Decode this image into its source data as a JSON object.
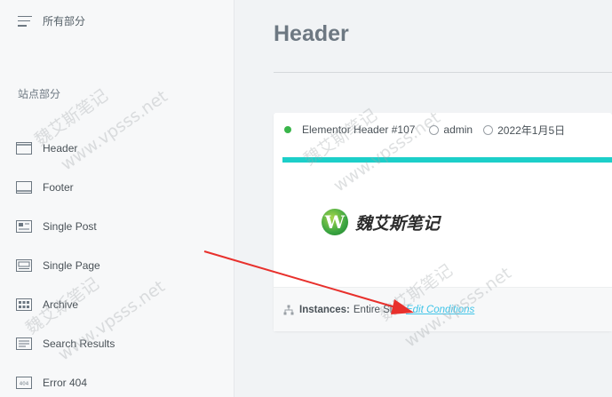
{
  "sidebar": {
    "top_nav": {
      "label": "所有部分"
    },
    "section_title": "站点部分",
    "items": [
      {
        "label": "Header",
        "icon": "header-layout-icon"
      },
      {
        "label": "Footer",
        "icon": "footer-layout-icon"
      },
      {
        "label": "Single Post",
        "icon": "single-post-icon"
      },
      {
        "label": "Single Page",
        "icon": "single-page-icon"
      },
      {
        "label": "Archive",
        "icon": "archive-grid-icon"
      },
      {
        "label": "Search Results",
        "icon": "search-results-icon"
      },
      {
        "label": "Error 404",
        "icon": "error-404-icon"
      }
    ]
  },
  "main": {
    "title": "Header",
    "card": {
      "status_color": "#39b54a",
      "title": "Elementor Header #107",
      "author": "admin",
      "date": "2022年1月5日",
      "accent_color": "#1ccfc9",
      "logo_text": "魏艾斯笔记",
      "logo_letter": "W",
      "instances_label": "Instances:",
      "instances_value": "Entire Site",
      "edit_link": "Edit Conditions"
    }
  },
  "watermark": {
    "text_cn": "魏艾斯笔记",
    "text_url": "www.vpsss.net"
  },
  "annotation": {
    "arrow_color": "#e8302c"
  }
}
